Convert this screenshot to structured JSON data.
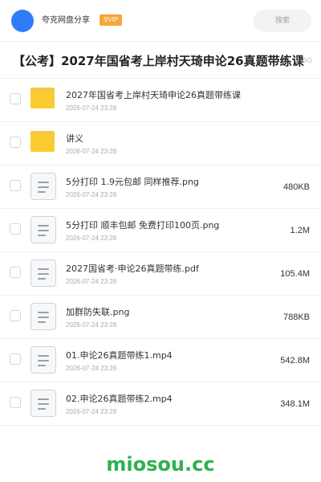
{
  "header": {
    "avatar_icon": "avatar",
    "username": "夸克网盘分享",
    "vip_badge": "SVIP",
    "search_placeholder": "搜索"
  },
  "folder": {
    "title": "【公考】2027年国省考上岸村天琦申论26真题带练课",
    "size": "2.6G"
  },
  "files": [
    {
      "type": "folder",
      "icon": "folder-icon",
      "name": "2027年国省考上岸村天琦申论26真题带练课",
      "date": "2026-07-24 23:28",
      "size": ""
    },
    {
      "type": "folder",
      "icon": "folder-icon",
      "name": "讲义",
      "date": "2026-07-24 23:28",
      "size": ""
    },
    {
      "type": "file",
      "icon": "document-icon",
      "name": "5分打印  1.9元包邮 同样推荐.png",
      "date": "2026-07-24 23:28",
      "size": "480KB"
    },
    {
      "type": "file",
      "icon": "document-icon",
      "name": "5分打印 顺丰包邮 免费打印100页.png",
      "date": "2026-07-24 23:28",
      "size": "1.2M"
    },
    {
      "type": "file",
      "icon": "document-icon",
      "name": "2027国省考·申论26真题带练.pdf",
      "date": "2026-07-24 23:28",
      "size": "105.4M"
    },
    {
      "type": "file",
      "icon": "document-icon",
      "name": "加群防失联.png",
      "date": "2026-07-24 23:28",
      "size": "788KB"
    },
    {
      "type": "file",
      "icon": "document-icon",
      "name": "01.申论26真题带练1.mp4",
      "date": "2026-07-24 23:28",
      "size": "542.8M"
    },
    {
      "type": "file",
      "icon": "document-icon",
      "name": "02.申论26真题带练2.mp4",
      "date": "2026-07-24 23:28",
      "size": "348.1M"
    }
  ],
  "watermark": "miosou.cc",
  "colors": {
    "accent": "#2f7cf6",
    "vip": "#f6a53b",
    "folder": "#fbcb31",
    "watermark": "#2fb04f"
  }
}
